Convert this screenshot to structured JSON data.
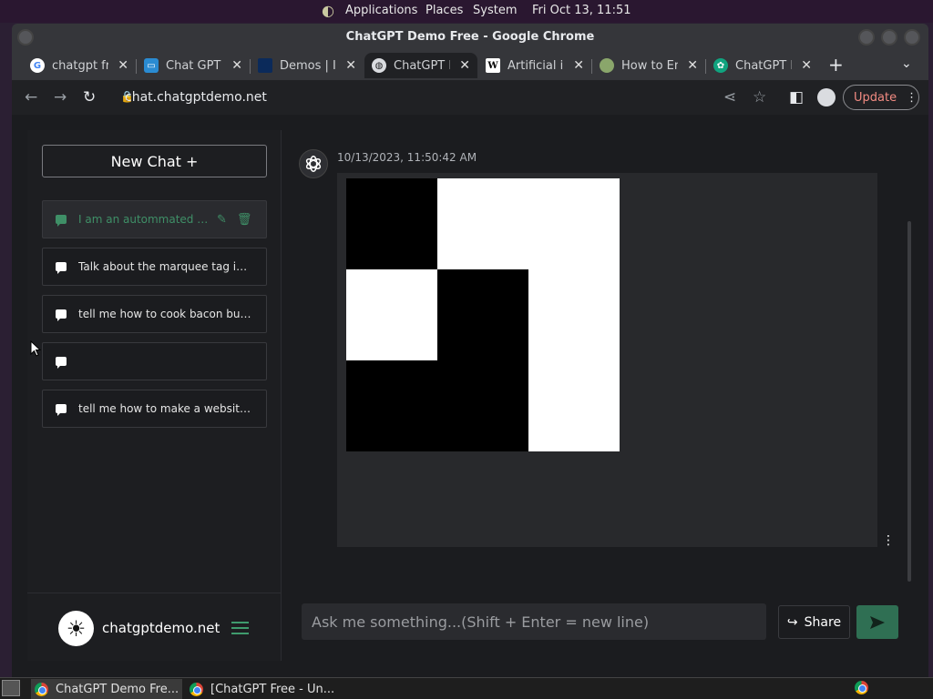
{
  "top_panel": {
    "menus": [
      "Applications",
      "Places",
      "System"
    ],
    "clock": "Fri Oct 13, 11:51"
  },
  "window": {
    "title": "ChatGPT Demo Free - Google Chrome",
    "tabs": [
      {
        "label": "chatgpt fre",
        "icon": "google-icon",
        "active": false
      },
      {
        "label": "Chat GPT C",
        "icon": "chat-bubble-icon",
        "active": false
      },
      {
        "label": "Demos | In",
        "icon": "square-icon",
        "active": false
      },
      {
        "label": "ChatGPT D",
        "icon": "globe-icon",
        "active": true
      },
      {
        "label": "Artificial in",
        "icon": "wikipedia-icon",
        "active": false
      },
      {
        "label": "How to En",
        "icon": "site-icon",
        "active": false
      },
      {
        "label": "ChatGPT F",
        "icon": "openai-icon",
        "active": false
      }
    ],
    "url": "chat.chatgptdemo.net",
    "update_label": "Update"
  },
  "sidebar": {
    "new_chat_label": "New Chat +",
    "conversations": [
      {
        "title": "I am an autommated scri...",
        "active": true
      },
      {
        "title": "Talk about the marquee tag in gre...",
        "active": false
      },
      {
        "title": "tell me how to cook bacon but wri...",
        "active": false
      },
      {
        "title": "",
        "active": false
      },
      {
        "title": "tell me how to make a website but...",
        "active": false
      }
    ],
    "site_name": "chatgptdemo.net"
  },
  "chat": {
    "timestamp": "10/13/2023, 11:50:42 AM",
    "image_grid": {
      "rows": 3,
      "cols": 3,
      "cells": [
        "black",
        "white",
        "white",
        "white",
        "black",
        "white",
        "black",
        "black",
        "white"
      ]
    },
    "composer_placeholder": "Ask me something...(Shift + Enter = new line)",
    "share_label": "Share"
  },
  "taskbar": {
    "items": [
      {
        "label": "ChatGPT Demo Fre...",
        "active": true
      },
      {
        "label": "[ChatGPT Free - Un...",
        "active": false
      }
    ]
  },
  "colors": {
    "accent_green": "#3f8f67",
    "send_button": "#2f6f53",
    "update_text": "#f28b82"
  }
}
